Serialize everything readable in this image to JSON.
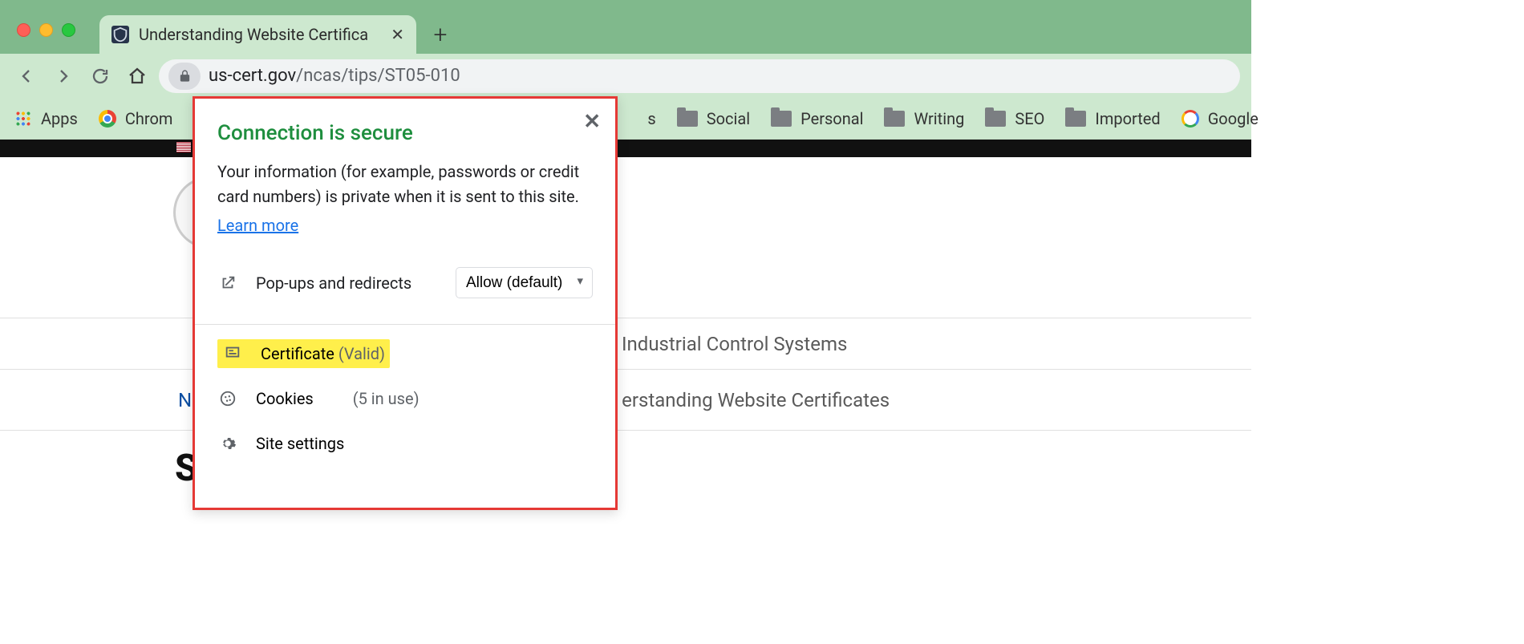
{
  "tab": {
    "title": "Understanding Website Certifica"
  },
  "url": {
    "host": "us-cert.gov",
    "path": "/ncas/tips/ST05-010"
  },
  "bookmarks": {
    "apps": "Apps",
    "chrome": "Chrom",
    "partial": "s",
    "folders": [
      "Social",
      "Personal",
      "Writing",
      "SEO",
      "Imported"
    ],
    "google": "Google"
  },
  "page": {
    "nav1": "Industrial Control Systems",
    "bc_initial": "N",
    "bc_last": "erstanding Website Certificates",
    "heading_vis": "S"
  },
  "popup": {
    "title": "Connection is secure",
    "desc": "Your information (for example, passwords or credit card numbers) is private when it is sent to this site.",
    "learn": "Learn more",
    "popups_label": "Pop-ups and redirects",
    "popups_value": "Allow (default)",
    "cert_label": "Certificate",
    "cert_status": "(Valid)",
    "cookies_label": "Cookies",
    "cookies_status": "(5 in use)",
    "settings_label": "Site settings"
  }
}
